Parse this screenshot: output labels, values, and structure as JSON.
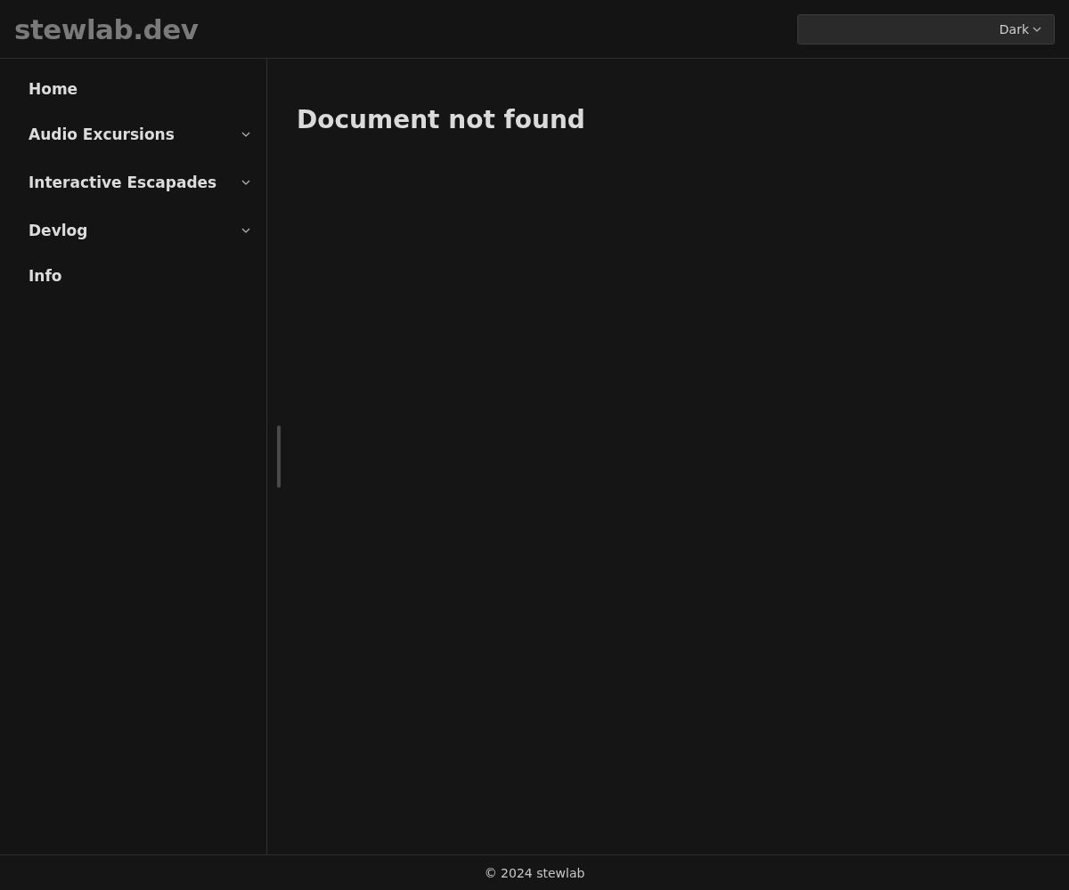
{
  "header": {
    "logo": "stewlab.dev",
    "theme_select": {
      "value": "Dark"
    }
  },
  "sidebar": {
    "items": [
      {
        "kind": "link",
        "label": "Home"
      },
      {
        "kind": "group",
        "label": "Audio Excursions",
        "expanded": false
      },
      {
        "kind": "group",
        "label": "Interactive Escapades",
        "expanded": false
      },
      {
        "kind": "group",
        "label": "Devlog",
        "expanded": false
      },
      {
        "kind": "link",
        "label": "Info"
      }
    ]
  },
  "content": {
    "heading": "Document not found"
  },
  "footer": {
    "text": "© 2024 stewlab"
  }
}
